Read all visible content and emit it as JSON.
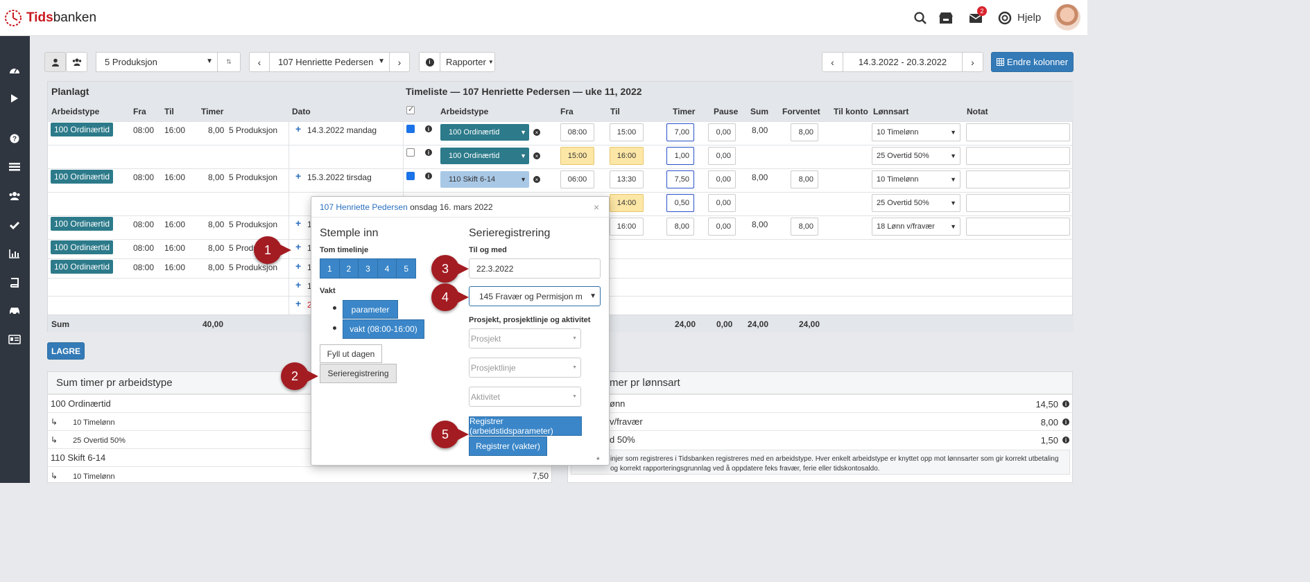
{
  "brand": {
    "part1": "Tids",
    "part2": "banken"
  },
  "header": {
    "help_label": "Hjelp",
    "mail_badge": "2"
  },
  "toolbar": {
    "department_select": "5 Produksjon",
    "employee_select": "107 Henriette Pedersen",
    "reports_label": "Rapporter",
    "date_range": "14.3.2022 - 20.3.2022",
    "change_columns_label": "Endre kolonner"
  },
  "table": {
    "planned_title": "Planlagt",
    "timesheet_title": "Timeliste — 107 Henriette Pedersen — uke 11, 2022",
    "columns_left": [
      "Arbeidstype",
      "Fra",
      "Til",
      "Timer",
      "Dato"
    ],
    "columns_right": [
      "Arbeidstype",
      "Fra",
      "Til",
      "Timer",
      "Pause",
      "Sum",
      "Forventet",
      "Til konto",
      "Lønnsart",
      "Notat"
    ],
    "rows": [
      {
        "type": "100 Ordinærtid",
        "from": "08:00",
        "to": "16:00",
        "hours": "8,00",
        "dept": "5 Produksjon",
        "date": "14.3.2022 mandag",
        "checked": true,
        "worktype": "100 Ordinærtid",
        "r_from": "08:00",
        "r_to": "15:00",
        "r_hours": "7,00",
        "pause": "0,00",
        "sum": "8,00",
        "expected": "8,00",
        "wage": "10 Timelønn"
      },
      {
        "type": "",
        "from": "",
        "to": "",
        "hours": "",
        "dept": "",
        "date": "",
        "checked": false,
        "worktype": "100 Ordinærtid",
        "r_from": "15:00",
        "r_to": "16:00",
        "r_hours": "1,00",
        "pause": "0,00",
        "sum": "",
        "expected": "",
        "wage": "25 Overtid 50%"
      },
      {
        "type": "100 Ordinærtid",
        "from": "08:00",
        "to": "16:00",
        "hours": "8,00",
        "dept": "5 Produksjon",
        "date": "15.3.2022 tirsdag",
        "checked": true,
        "worktype": "110 Skift 6-14",
        "r_from": "06:00",
        "r_to": "13:30",
        "r_hours": "7,50",
        "pause": "0,00",
        "sum": "8,00",
        "expected": "8,00",
        "wage": "10 Timelønn"
      },
      {
        "type": "",
        "from": "",
        "to": "",
        "hours": "",
        "dept": "",
        "date": "",
        "r_to": "14:00",
        "r_hours": "0,50",
        "pause": "0,00",
        "wage": "25 Overtid 50%"
      },
      {
        "type": "100 Ordinærtid",
        "from": "08:00",
        "to": "16:00",
        "hours": "8,00",
        "dept": "5 Produksjon",
        "date_prefix": "1",
        "r_to": "16:00",
        "r_hours": "8,00",
        "pause": "0,00",
        "sum": "8,00",
        "expected": "8,00",
        "wage": "18 Lønn v/fravær"
      },
      {
        "type": "100 Ordinærtid",
        "from": "08:00",
        "to": "16:00",
        "hours": "8,00",
        "dept": "5 Produ",
        "date_prefix": "1"
      },
      {
        "type": "100 Ordinærtid",
        "from": "08:00",
        "to": "16:00",
        "hours": "8,00",
        "dept": "5 Produksjon",
        "date_prefix": "1"
      },
      {
        "date_prefix": "1"
      },
      {
        "date_prefix": "2"
      }
    ],
    "sum_label": "Sum",
    "sum_planned": "40,00",
    "sum_hours": "24,00",
    "sum_pause": "0,00",
    "sum_sum": "24,00",
    "sum_expected": "24,00"
  },
  "save_label": "LAGRE",
  "left_panel": {
    "title": "Sum timer pr arbeidstype",
    "rows": [
      {
        "label": "100 Ordinærtid",
        "value": ""
      },
      {
        "label": "10 Timelønn",
        "value": "",
        "sub": true
      },
      {
        "label": "25 Overtid 50%",
        "value": "",
        "sub": true
      },
      {
        "label": "110 Skift 6-14",
        "value": ""
      },
      {
        "label": "10 Timelønn",
        "value": "7,50",
        "sub": true
      }
    ]
  },
  "right_panel": {
    "title": "mer pr lønnsart",
    "rows": [
      {
        "label": "ønn",
        "value": "14,50"
      },
      {
        "label": "v/fravær",
        "value": "8,00"
      },
      {
        "label": "d 50%",
        "value": "1,50"
      }
    ],
    "footnote": "injer som registreres i Tidsbanken registreres med en arbeidstype. Hver enkelt arbeidstype er knyttet opp mot lønnsarter som gir korrekt utbetaling og korrekt rapporteringsgrunnlag ved å oppdatere feks fravær, ferie eller tidskontosaldo."
  },
  "popup": {
    "name_link": "107 Henriette Pedersen",
    "date_text": "onsdag 16. mars 2022",
    "close": "×",
    "stemple_title": "Stemple inn",
    "empty_line_label": "Tom timelinje",
    "numbers": [
      "1",
      "2",
      "3",
      "4",
      "5"
    ],
    "vakt_label": "Vakt",
    "vakt_items": [
      "parameter",
      "vakt (08:00-16:00)"
    ],
    "fill_day": "Fyll ut dagen",
    "series_btn": "Serieregistrering",
    "series_title": "Serieregistrering",
    "until_label": "Til og med",
    "until_value": "22.3.2022",
    "type_select": "145 Fravær og Permisjon m",
    "project_label": "Prosjekt, prosjektlinje og aktivitet",
    "project_placeholder": "Prosjekt",
    "projectline_placeholder": "Prosjektlinje",
    "activity_placeholder": "Aktivitet",
    "register_params": "Registrer (arbeidstidsparameter)",
    "register_shifts": "Registrer (vakter)",
    "asterisk": "*"
  },
  "markers": [
    "1",
    "2",
    "3",
    "4",
    "5"
  ]
}
